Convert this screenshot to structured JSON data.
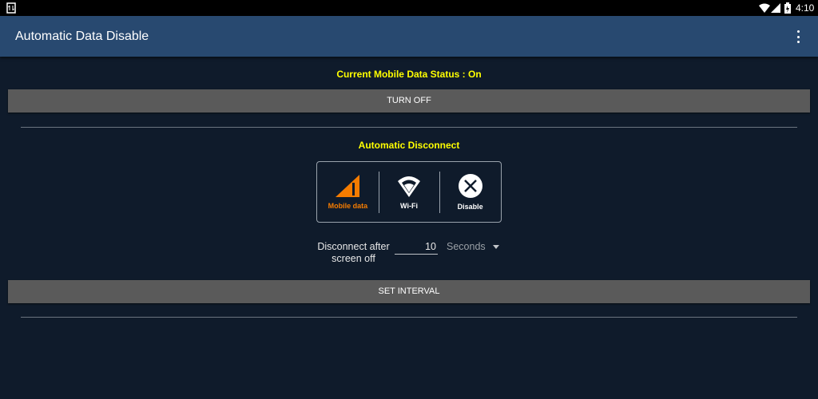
{
  "status_bar": {
    "time": "4:10"
  },
  "app_bar": {
    "title": "Automatic Data Disable"
  },
  "data_status": {
    "text": "Current Mobile Data Status : On",
    "button": "TURN OFF"
  },
  "auto_disconnect": {
    "heading": "Automatic Disconnect",
    "options": [
      {
        "label": "Mobile data",
        "icon": "signal-icon",
        "selected": true
      },
      {
        "label": "Wi-Fi",
        "icon": "wifi-icon",
        "selected": false
      },
      {
        "label": "Disable",
        "icon": "close-circle-icon",
        "selected": false
      }
    ],
    "accent": "#f57c00",
    "interval_label_1": "Disconnect after",
    "interval_label_2": "screen off",
    "interval_value": "10",
    "unit": "Seconds",
    "button": "SET INTERVAL"
  }
}
